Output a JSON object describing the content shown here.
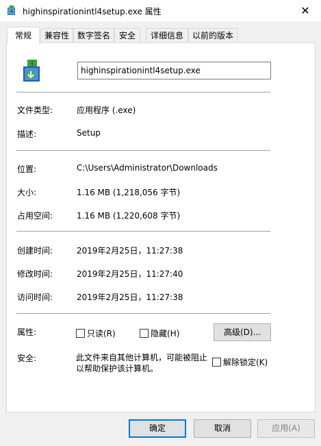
{
  "window": {
    "title": "highinspirationintl4setup.exe 属性",
    "close_symbol": "✕"
  },
  "tabs": [
    {
      "label": "常规",
      "active": true
    },
    {
      "label": "兼容性"
    },
    {
      "label": "数字签名"
    },
    {
      "label": "安全"
    },
    {
      "label": "详细信息"
    },
    {
      "label": "以前的版本"
    }
  ],
  "general": {
    "file_name": "highinspirationintl4setup.exe",
    "file_type_label": "文件类型:",
    "file_type_value": "应用程序 (.exe)",
    "description_label": "描述:",
    "description_value": "Setup",
    "location_label": "位置:",
    "location_value": "C:\\Users\\Administrator\\Downloads",
    "size_label": "大小:",
    "size_value": "1.16 MB (1,218,056 字节)",
    "size_on_disk_label": "占用空间:",
    "size_on_disk_value": "1.16 MB (1,220,608 字节)",
    "created_label": "创建时间:",
    "created_value": "2019年2月25日，11:27:38",
    "modified_label": "修改时间:",
    "modified_value": "2019年2月25日，11:27:40",
    "accessed_label": "访问时间:",
    "accessed_value": "2019年2月25日，11:27:38",
    "attributes_label": "属性:",
    "readonly_label": "只读(R)",
    "hidden_label": "隐藏(H)",
    "advanced_button": "高级(D)...",
    "security_label": "安全:",
    "security_line1": "此文件来自其他计算机，可能被阻止",
    "security_line2": "以帮助保护该计算机。",
    "unblock_label": "解除锁定(K)"
  },
  "footer": {
    "ok": "确定",
    "cancel": "取消",
    "apply": "应用(A)"
  },
  "icons": {
    "app_icon": "installer-box-icon",
    "file_icon": "installer-box-icon"
  },
  "colors": {
    "default_button_border": "#0078d7",
    "panel_bg": "#ffffff",
    "dialog_bg": "#f0f0f0"
  }
}
